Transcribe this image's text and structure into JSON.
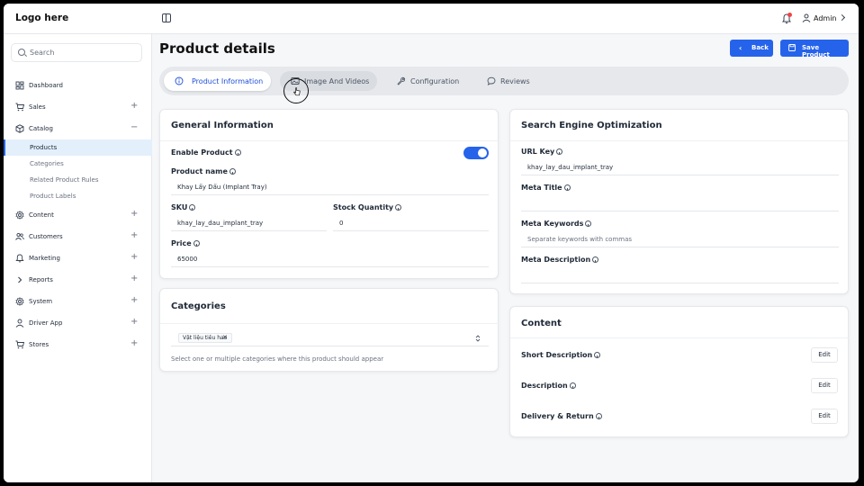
{
  "header": {
    "logo": "Logo here",
    "user_name": "Admin"
  },
  "sidebar": {
    "search_placeholder": "Search",
    "items": [
      {
        "label": "Dashboard",
        "expandable": false
      },
      {
        "label": "Sales",
        "expandable": true,
        "toggle": "+"
      },
      {
        "label": "Catalog",
        "expandable": true,
        "toggle": "−"
      },
      {
        "label": "Content",
        "expandable": true,
        "toggle": "+"
      },
      {
        "label": "Customers",
        "expandable": true,
        "toggle": "+"
      },
      {
        "label": "Marketing",
        "expandable": true,
        "toggle": "+"
      },
      {
        "label": "Reports",
        "expandable": true,
        "toggle": "+"
      },
      {
        "label": "System",
        "expandable": true,
        "toggle": "+"
      },
      {
        "label": "Driver App",
        "expandable": true,
        "toggle": "+"
      },
      {
        "label": "Stores",
        "expandable": true,
        "toggle": "+"
      }
    ],
    "catalog_sub": [
      {
        "label": "Products",
        "active": true
      },
      {
        "label": "Categories",
        "active": false
      },
      {
        "label": "Related Product Rules",
        "active": false
      },
      {
        "label": "Product Labels",
        "active": false
      }
    ]
  },
  "page": {
    "title": "Product details",
    "back_label": "Back",
    "save_label": "Save Product",
    "accent": "#2563eb"
  },
  "tabs": [
    {
      "label": "Product Information",
      "icon": "info-icon",
      "active": true
    },
    {
      "label": "Image And Videos",
      "icon": "image-icon",
      "active": false
    },
    {
      "label": "Configuration",
      "icon": "wrench-icon",
      "active": false
    },
    {
      "label": "Reviews",
      "icon": "chat-icon",
      "active": false
    }
  ],
  "general": {
    "title": "General Information",
    "enable_label": "Enable Product",
    "enable_value": true,
    "name_label": "Product name",
    "name_value": "Khay Lấy Dấu (Implant Tray)",
    "sku_label": "SKU",
    "sku_value": "khay_lay_dau_implant_tray",
    "stock_label": "Stock Quantity",
    "stock_value": "0",
    "price_label": "Price",
    "price_value": "65000"
  },
  "categories": {
    "title": "Categories",
    "selected": [
      "Vật liệu tiêu hao"
    ],
    "helper": "Select one or multiple categories where this product should appear"
  },
  "seo": {
    "title": "Search Engine Optimization",
    "url_key_label": "URL Key",
    "url_key_value": "khay_lay_dau_implant_tray",
    "meta_title_label": "Meta Title",
    "meta_title_value": "",
    "meta_keywords_label": "Meta Keywords",
    "meta_keywords_placeholder": "Separate keywords with commas",
    "meta_description_label": "Meta Description",
    "meta_description_value": ""
  },
  "content": {
    "title": "Content",
    "rows": [
      {
        "label": "Short Description",
        "action": "Edit"
      },
      {
        "label": "Description",
        "action": "Edit"
      },
      {
        "label": "Delivery & Return",
        "action": "Edit"
      }
    ]
  }
}
